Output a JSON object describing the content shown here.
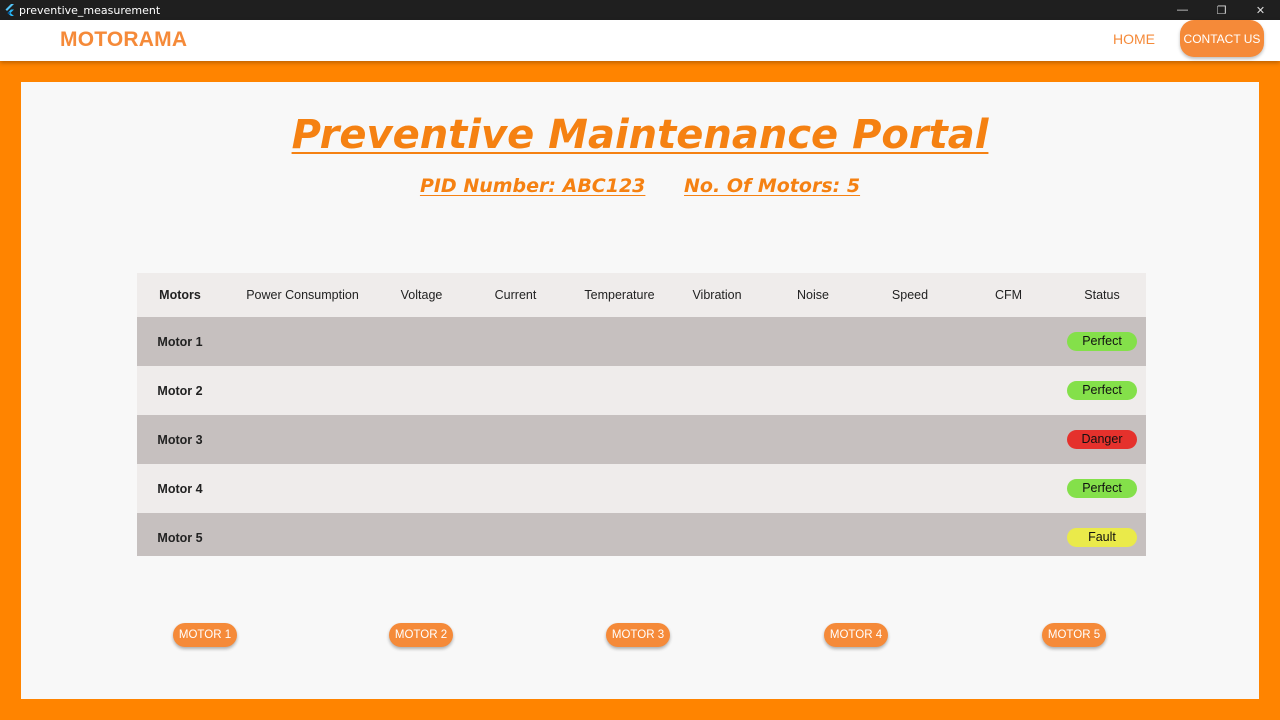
{
  "window": {
    "title": "preventive_measurement"
  },
  "navbar": {
    "brand": "MOTORAMA",
    "home": "HOME",
    "contact": "CONTACT US"
  },
  "header": {
    "title": "Preventive Maintenance Portal",
    "pid": "PID Number: ABC123",
    "motor_count": "No. Of Motors: 5"
  },
  "table": {
    "columns": [
      "Motors",
      "Power Consumption",
      "Voltage",
      "Current",
      "Temperature",
      "Vibration",
      "Noise",
      "Speed",
      "CFM",
      "Status"
    ],
    "rows": [
      {
        "name": "Motor 1",
        "status": "Perfect"
      },
      {
        "name": "Motor 2",
        "status": "Perfect"
      },
      {
        "name": "Motor 3",
        "status": "Danger"
      },
      {
        "name": "Motor 4",
        "status": "Perfect"
      },
      {
        "name": "Motor 5",
        "status": "Fault"
      }
    ]
  },
  "status_colors": {
    "Perfect": "#84e04a",
    "Danger": "#e5312c",
    "Fault": "#eaea4a"
  },
  "motor_buttons": [
    "MOTOR 1",
    "MOTOR 2",
    "MOTOR 3",
    "MOTOR 4",
    "MOTOR 5"
  ]
}
